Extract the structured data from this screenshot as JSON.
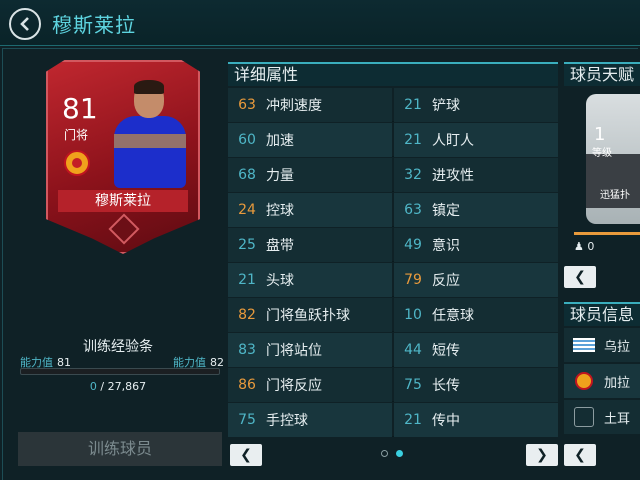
{
  "header": {
    "title": "穆斯莱拉"
  },
  "card": {
    "rating": "81",
    "position": "门将",
    "name": "穆斯莱拉"
  },
  "training": {
    "label": "训练经验条",
    "ability_label": "能力值",
    "ability_current": "81",
    "ability_next": "82",
    "xp_current": "0",
    "xp_separator": "/",
    "xp_total": "27,867",
    "progress_fraction": 0.0,
    "button": "训练球员"
  },
  "stats": {
    "title": "详细属性",
    "rows": [
      {
        "lv": "63",
        "ln": "冲刺速度",
        "rv": "21",
        "rn": "铲球",
        "lc": "orange",
        "rc": "blue"
      },
      {
        "lv": "60",
        "ln": "加速",
        "rv": "21",
        "rn": "人盯人",
        "lc": "blue",
        "rc": "blue"
      },
      {
        "lv": "68",
        "ln": "力量",
        "rv": "32",
        "rn": "进攻性",
        "lc": "blue",
        "rc": "blue"
      },
      {
        "lv": "24",
        "ln": "控球",
        "rv": "63",
        "rn": "镇定",
        "lc": "orange",
        "rc": "blue"
      },
      {
        "lv": "25",
        "ln": "盘带",
        "rv": "49",
        "rn": "意识",
        "lc": "blue",
        "rc": "blue"
      },
      {
        "lv": "21",
        "ln": "头球",
        "rv": "79",
        "rn": "反应",
        "lc": "blue",
        "rc": "orange"
      },
      {
        "lv": "82",
        "ln": "门将鱼跃扑球",
        "rv": "10",
        "rn": "任意球",
        "lc": "orange",
        "rc": "blue"
      },
      {
        "lv": "83",
        "ln": "门将站位",
        "rv": "44",
        "rn": "短传",
        "lc": "blue",
        "rc": "blue"
      },
      {
        "lv": "86",
        "ln": "门将反应",
        "rv": "75",
        "rn": "长传",
        "lc": "orange",
        "rc": "blue"
      },
      {
        "lv": "75",
        "ln": "手控球",
        "rv": "21",
        "rn": "传中",
        "lc": "blue",
        "rc": "blue"
      }
    ],
    "prev_icon": "chevron-left-icon",
    "next_icon": "chevron-right-icon"
  },
  "talent": {
    "title": "球员天赋",
    "level": "1",
    "level_label": "等级",
    "name": "迅猛扑",
    "likes": "0"
  },
  "info": {
    "title": "球员信息",
    "rows": [
      {
        "icon": "uruguay-flag-icon",
        "text": "乌拉"
      },
      {
        "icon": "galatasaray-badge-icon",
        "text": "加拉"
      },
      {
        "icon": "super-lig-icon",
        "text": "土耳"
      }
    ]
  },
  "colors": {
    "accent": "#4fb6c7",
    "highlight": "#e89a3c",
    "card_red": "#b5222a"
  }
}
